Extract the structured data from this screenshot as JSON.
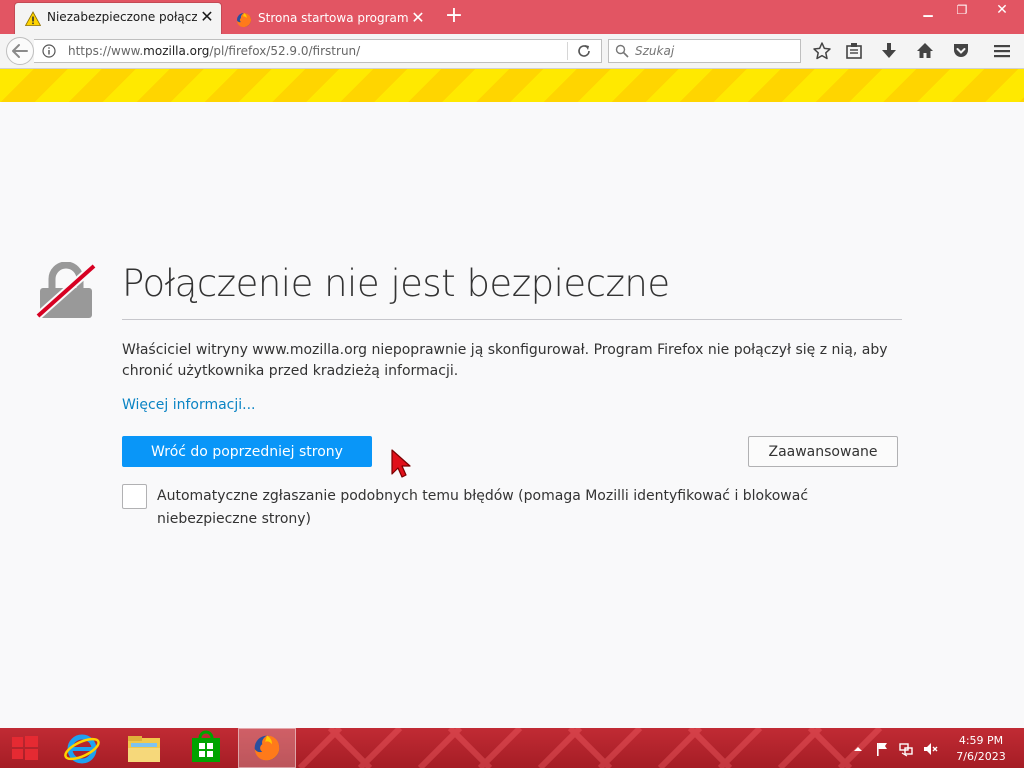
{
  "browser": {
    "tabs": [
      {
        "title": "Niezabezpieczone połącze...",
        "icon": "warning-icon",
        "active": true
      },
      {
        "title": "Strona startowa programu...",
        "icon": "firefox-icon",
        "active": false
      }
    ],
    "url": {
      "prefix": "https://www.",
      "domain": "mozilla.org",
      "path": "/pl/firefox/52.9.0/firstrun/"
    },
    "search_placeholder": "Szukaj",
    "toolbar_icons": [
      "bookmark-star-icon",
      "reading-list-icon",
      "download-icon",
      "home-icon",
      "pocket-icon",
      "menu-icon"
    ]
  },
  "error_page": {
    "title": "Połączenie nie jest bezpieczne",
    "description": "Właściciel witryny www.mozilla.org niepoprawnie ją skonfigurował. Program Firefox nie połączył się z nią, aby chronić użytkownika przed kradzieżą informacji.",
    "learn_more": "Więcej informacji...",
    "go_back_button": "Wróć do poprzedniej strony",
    "advanced_button": "Zaawansowane",
    "report_checkbox_label": "Automatyczne zgłaszanie podobnych temu błędów (pomaga Mozilli identyfikować i blokować niebezpieczne strony)",
    "report_checked": false
  },
  "taskbar": {
    "apps": [
      "start-icon",
      "internet-explorer-icon",
      "file-explorer-icon",
      "store-icon",
      "firefox-icon"
    ],
    "clock_time": "4:59 PM",
    "clock_date": "7/6/2023"
  },
  "colors": {
    "titlebar": "#e25563",
    "warning_stripe_a": "#ffe900",
    "warning_stripe_b": "#ffd500",
    "primary_button": "#0996f8",
    "link": "#0a84c4",
    "taskbar": "#b8232c"
  }
}
